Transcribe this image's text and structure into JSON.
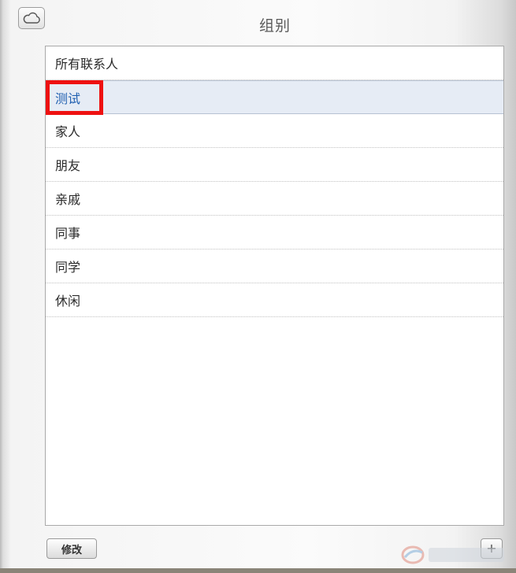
{
  "header": {
    "title": "组别",
    "cloud_icon": "cloud-icon"
  },
  "groups": {
    "items": [
      {
        "label": "所有联系人"
      },
      {
        "label": "测试",
        "selected": true
      },
      {
        "label": "家人"
      },
      {
        "label": "朋友"
      },
      {
        "label": "亲戚"
      },
      {
        "label": "同事"
      },
      {
        "label": "同学"
      },
      {
        "label": "休闲"
      }
    ]
  },
  "footer": {
    "edit_label": "修改",
    "add_label": "+"
  },
  "colors": {
    "selected_text": "#1f5fb0",
    "selected_bg": "#e6ecf5",
    "highlight": "#ee1111"
  }
}
